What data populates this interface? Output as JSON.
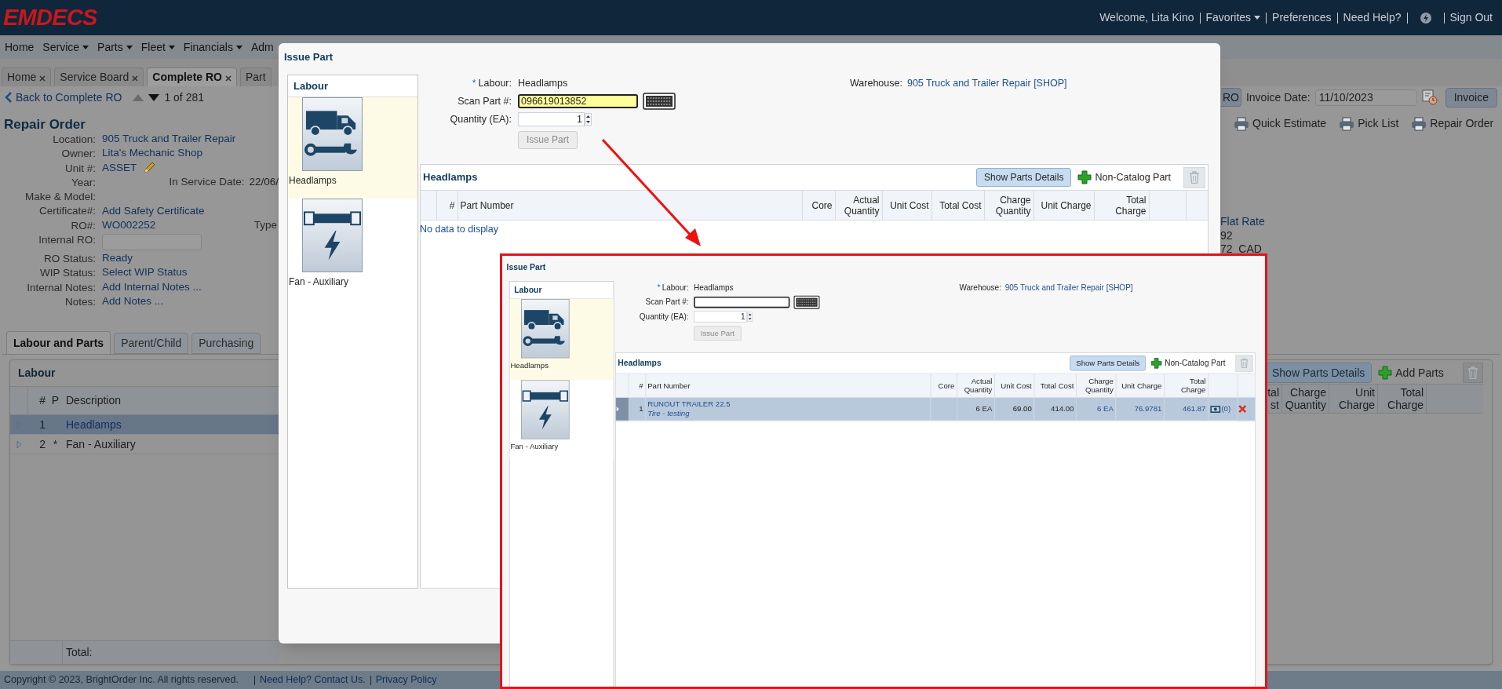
{
  "header": {
    "logo": "EMDECS",
    "items": [
      {
        "kind": "text",
        "text": "Welcome, Lita Kino"
      },
      {
        "kind": "dropdown",
        "text": "Favorites"
      },
      {
        "kind": "link",
        "text": "Preferences"
      },
      {
        "kind": "link",
        "text": "Need Help?"
      },
      {
        "kind": "icon"
      },
      {
        "kind": "link",
        "text": "Sign Out"
      }
    ]
  },
  "menu": [
    {
      "label": "Home",
      "dropdown": false
    },
    {
      "label": "Service",
      "dropdown": true
    },
    {
      "label": "Parts",
      "dropdown": true
    },
    {
      "label": "Fleet",
      "dropdown": true
    },
    {
      "label": "Financials",
      "dropdown": true
    },
    {
      "label": "Adm",
      "dropdown": false
    }
  ],
  "tabs": [
    {
      "label": "Home",
      "selected": false,
      "closable": true
    },
    {
      "label": "Service Board",
      "selected": false,
      "closable": true
    },
    {
      "label": "Complete RO",
      "selected": true,
      "closable": true
    },
    {
      "label": "Part",
      "selected": false,
      "closable": false
    }
  ],
  "toolbar": {
    "back_link": "Back to Complete RO",
    "pager": "1 of 281",
    "ro_button": "RO",
    "invoice_date_label": "Invoice Date:",
    "invoice_date": "11/10/2023",
    "invoice_button": "Invoice"
  },
  "print_buttons": [
    "Quick Estimate",
    "Pick List",
    "Repair Order"
  ],
  "repair_order": {
    "title": "Repair Order",
    "fields": [
      {
        "label": "Location:",
        "value": "905 Truck and Trailer Repair",
        "kind": "text"
      },
      {
        "label": "Owner:",
        "value": "Lita's Mechanic Shop",
        "kind": "text"
      },
      {
        "label": "Unit #:",
        "value": "ASSET",
        "kind": "edit"
      },
      {
        "label": "Year:",
        "kind": "text",
        "extra_label": "In Service Date:",
        "extra_value": "22/06/"
      },
      {
        "label": "Make & Model:",
        "kind": "text"
      },
      {
        "label": "Certificate#:",
        "value": "Add Safety Certificate",
        "kind": "text"
      },
      {
        "label": "RO#:",
        "value": "WO002252",
        "kind": "text",
        "extra_label": "Type"
      },
      {
        "label": "Internal RO:",
        "kind": "input"
      },
      {
        "label": "RO Status:",
        "value": "Ready",
        "kind": "text"
      },
      {
        "label": "WIP Status:",
        "value": "Select WIP Status",
        "kind": "text"
      },
      {
        "label": "Internal Notes:",
        "value": "Add Internal Notes ...",
        "kind": "text"
      },
      {
        "label": "Notes:",
        "value": "Add Notes ...",
        "kind": "text"
      }
    ]
  },
  "summary": [
    "Flat Rate",
    "92",
    "72  CAD"
  ],
  "detail_tabs": [
    {
      "label": "Labour and Parts",
      "selected": true
    },
    {
      "label": "Parent/Child",
      "selected": false
    },
    {
      "label": "Purchasing",
      "selected": false
    }
  ],
  "labour_panel": {
    "title": "Labour",
    "columns": [
      "#",
      "P",
      "Description"
    ],
    "rows": [
      {
        "number": "1",
        "description": "Headlamps",
        "selected": true
      },
      {
        "number": "2",
        "p": "*",
        "description": "Fan - Auxiliary",
        "selected": false
      }
    ],
    "total_label": "Total:"
  },
  "parts_panel": {
    "show_details": "Show Parts Details",
    "add_parts": "Add Parts",
    "columns": [
      "tal st",
      "Charge Quantity",
      "Unit Charge",
      "Total Charge"
    ]
  },
  "footer": {
    "copyright": "Copyright © 2023, BrightOrder Inc. All rights reserved.",
    "links": [
      "Need Help? Contact Us.",
      "Privacy Policy"
    ]
  },
  "issue_part_dialog": {
    "title": "Issue Part",
    "labour_list": {
      "title": "Labour",
      "items": [
        {
          "label": "Headlamps",
          "kind": "vehicle",
          "selected": true
        },
        {
          "label": "Fan - Auxiliary",
          "kind": "electrical",
          "selected": false
        }
      ]
    },
    "form": {
      "required_mark": "*",
      "labour_label": "Labour:",
      "labour_value": "Headlamps",
      "scan_label": "Scan Part #:",
      "scan_value": "096619013852",
      "quantity_label": "Quantity (EA):",
      "quantity_value": "1",
      "issue_button": {
        "label": "Issue Part",
        "disabled": true
      },
      "warehouse_label": "Warehouse:",
      "warehouse_value": "905 Truck and Trailer Repair [SHOP]"
    },
    "grid": {
      "title": "Headlamps",
      "show_details": "Show Parts Details",
      "non_catalog": "Non-Catalog Part",
      "columns": [
        "#",
        "Part Number",
        "Core",
        "Actual Quantity",
        "Unit Cost",
        "Total Cost",
        "Charge Quantity",
        "Unit Charge",
        "Total Charge"
      ],
      "empty_text": "No data to display"
    }
  },
  "annotation_inset": {
    "title": "Issue Part",
    "labour_list": {
      "title": "Labour",
      "items": [
        {
          "label": "Headlamps",
          "kind": "vehicle",
          "selected": true
        },
        {
          "label": "Fan - Auxiliary",
          "kind": "electrical",
          "selected": false
        }
      ]
    },
    "form": {
      "required_mark": "*",
      "labour_label": "Labour:",
      "labour_value": "Headlamps",
      "scan_label": "Scan Part #:",
      "quantity_label": "Quantity (EA):",
      "quantity_value": "1",
      "issue_button": {
        "label": "Issue Part",
        "disabled": true
      },
      "warehouse_label": "Warehouse:",
      "warehouse_value": "905 Truck and Trailer Repair [SHOP]"
    },
    "grid": {
      "title": "Headlamps",
      "show_details": "Show Parts Details",
      "non_catalog": "Non-Catalog Part",
      "columns": [
        "#",
        "Part Number",
        "Core",
        "Actual Quantity",
        "Unit Cost",
        "Total Cost",
        "Charge Quantity",
        "Unit Charge",
        "Total Charge"
      ],
      "rows": [
        {
          "number": "1",
          "part_number": "RUNOUT TRAILER 22.5",
          "description": "Tire - testing",
          "actual_quantity": "6 EA",
          "unit_cost": "69.00",
          "total_cost": "414.00",
          "charge_quantity": "6 EA",
          "unit_charge": "76.9781",
          "total_charge": "461.87",
          "attachments": "(0)",
          "selected": true
        }
      ]
    }
  }
}
